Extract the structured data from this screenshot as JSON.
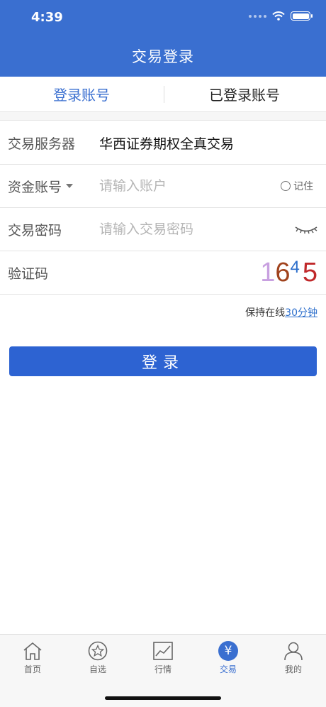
{
  "status_bar": {
    "time": "4:39"
  },
  "header": {
    "title": "交易登录"
  },
  "tabs": [
    {
      "label": "登录账号",
      "active": true
    },
    {
      "label": "已登录账号",
      "active": false
    }
  ],
  "form": {
    "server": {
      "label": "交易服务器",
      "value": "华西证券期权全真交易"
    },
    "account": {
      "label": "资金账号",
      "placeholder": "请输入账户",
      "remember_label": "记住"
    },
    "password": {
      "label": "交易密码",
      "placeholder": "请输入交易密码"
    },
    "captcha": {
      "label": "验证码",
      "digits": [
        "1",
        "6",
        "4",
        "5"
      ]
    }
  },
  "keep_online": {
    "prefix": "保持在线",
    "link": "30分钟"
  },
  "login_button": {
    "label": "登录"
  },
  "bottom_nav": [
    {
      "label": "首页",
      "icon": "home-icon",
      "active": false
    },
    {
      "label": "自选",
      "icon": "star-icon",
      "active": false
    },
    {
      "label": "行情",
      "icon": "chart-icon",
      "active": false
    },
    {
      "label": "交易",
      "icon": "yen-icon",
      "active": true
    },
    {
      "label": "我的",
      "icon": "user-icon",
      "active": false
    }
  ],
  "colors": {
    "primary": "#3a6fd0",
    "button": "#2d63d2",
    "link": "#2d6fcc"
  }
}
